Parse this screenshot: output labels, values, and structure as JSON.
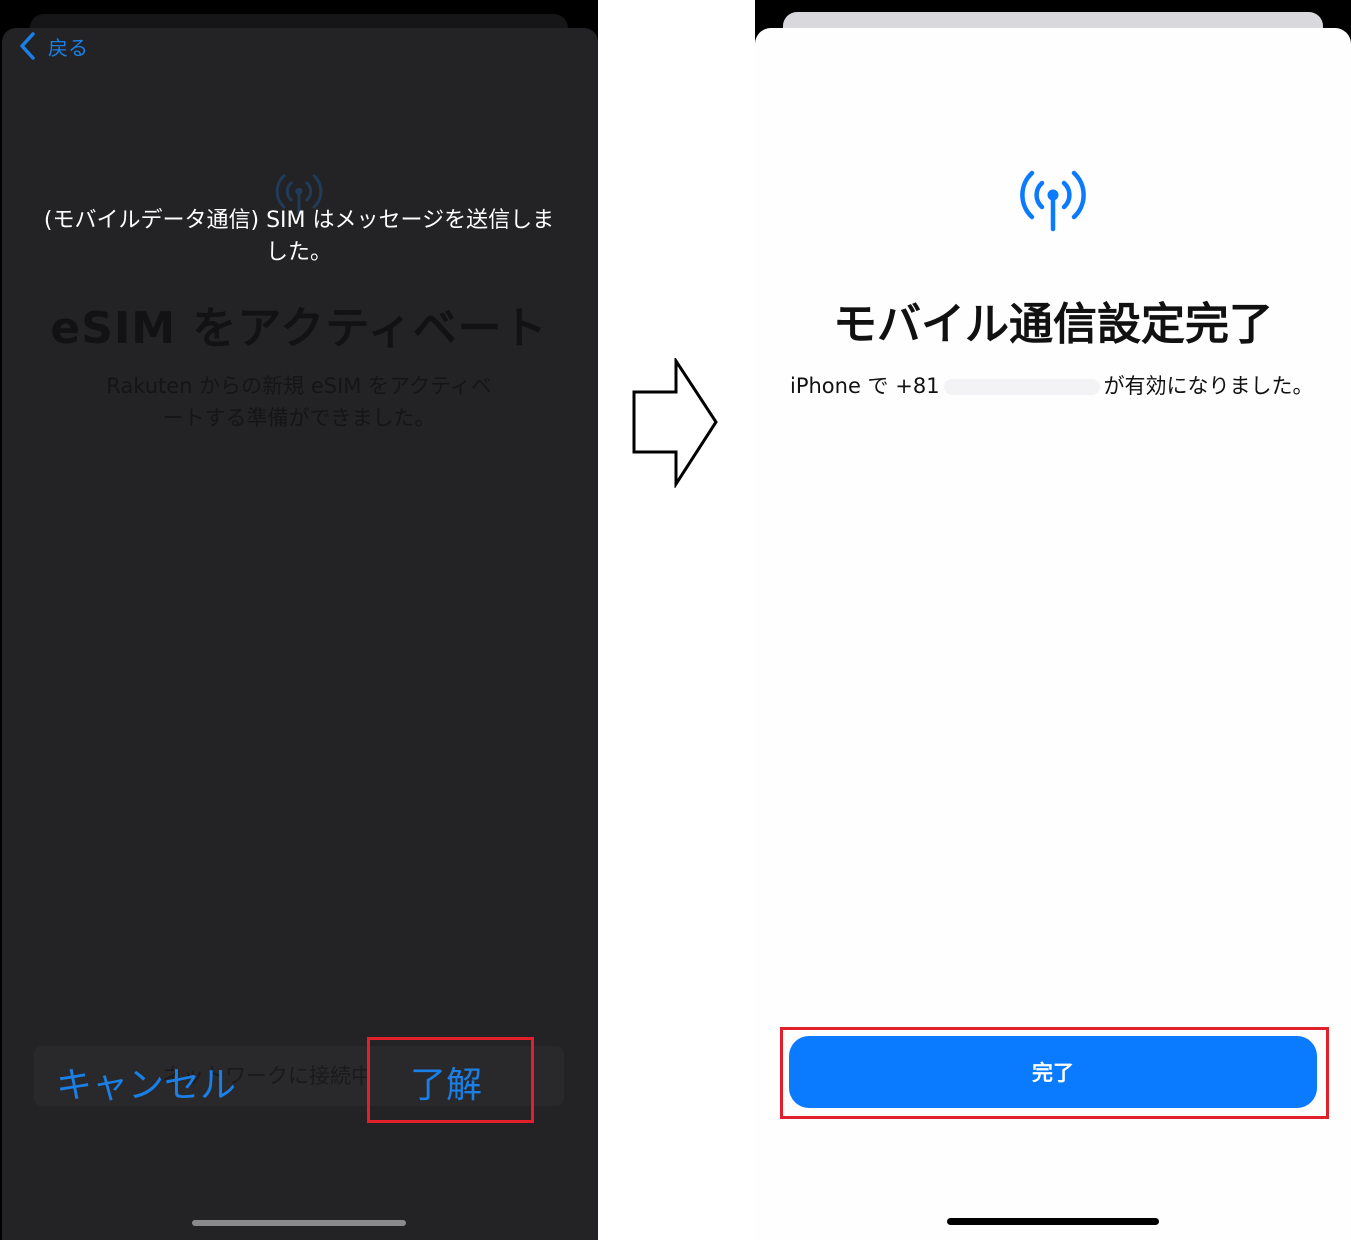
{
  "left": {
    "back_label": "戻る",
    "alert_message": "(モバイルデータ通信) SIM はメッセージを送信しました。",
    "title": "eSIM をアクティベート",
    "description": "Rakuten からの新規 eSIM をアクティベートする準備ができました。",
    "status": "ネットワークに接続中",
    "cancel_label": "キャンセル",
    "ok_label": "了解",
    "ghost_icon": "cellular-antenna-icon"
  },
  "transition_icon": "right-arrow-icon",
  "right": {
    "icon": "cellular-antenna-icon",
    "title": "モバイル通信設定完了",
    "desc_prefix": "iPhone で +81",
    "desc_suffix": "が有効になりました。",
    "done_label": "完了"
  },
  "colors": {
    "accent": "#0a7afe",
    "highlight": "#e0202a",
    "dark_bg": "#232325"
  }
}
